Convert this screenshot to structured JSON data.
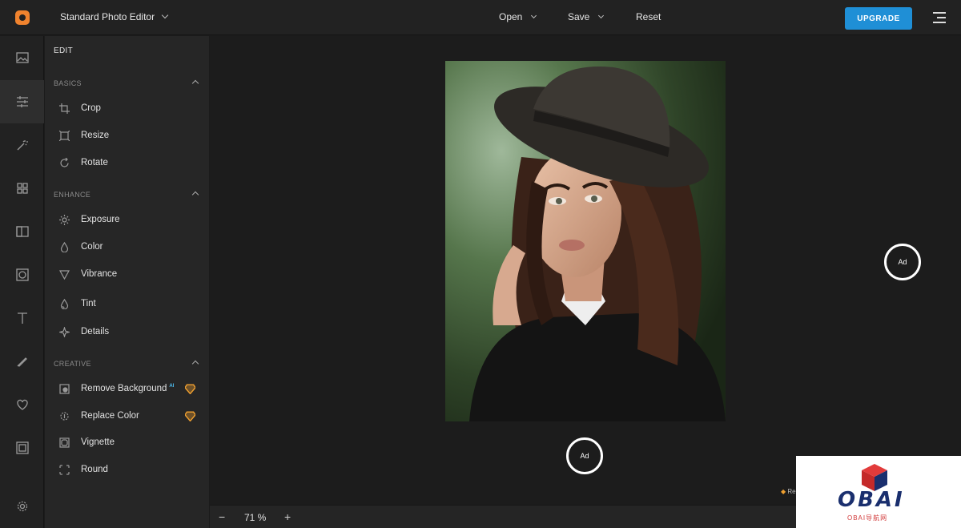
{
  "header": {
    "app_title": "Standard Photo Editor",
    "menu": [
      {
        "label": "Open"
      },
      {
        "label": "Save"
      },
      {
        "label": "Reset"
      }
    ],
    "upgrade_label": "UPGRADE"
  },
  "rail": {
    "items": [
      "image-icon",
      "sliders-icon",
      "magic-wand-icon",
      "grid-icon",
      "frame-icon",
      "overlay-icon",
      "text-icon",
      "brush-icon",
      "heart-icon",
      "border-icon",
      "settings-icon"
    ]
  },
  "panel": {
    "title": "EDIT",
    "sections": [
      {
        "name": "BASICS",
        "tools": [
          {
            "label": "Crop",
            "icon": "crop-icon"
          },
          {
            "label": "Resize",
            "icon": "resize-icon"
          },
          {
            "label": "Rotate",
            "icon": "rotate-icon"
          }
        ]
      },
      {
        "name": "ENHANCE",
        "tools": [
          {
            "label": "Exposure",
            "icon": "sun-icon"
          },
          {
            "label": "Color",
            "icon": "drop-icon"
          },
          {
            "label": "Vibrance",
            "icon": "triangle-icon"
          },
          {
            "label": "Tint",
            "icon": "tint-icon"
          },
          {
            "label": "Details",
            "icon": "sparkle-icon"
          }
        ]
      },
      {
        "name": "CREATIVE",
        "tools": [
          {
            "label": "Remove Background",
            "icon": "remove-bg-icon",
            "ai": "AI",
            "premium": true
          },
          {
            "label": "Replace Color",
            "icon": "replace-color-icon",
            "premium": true
          },
          {
            "label": "Vignette",
            "icon": "vignette-icon"
          },
          {
            "label": "Round",
            "icon": "round-icon"
          }
        ]
      }
    ]
  },
  "canvas": {
    "ad_label_right": "Ad",
    "ad_label_bottom": "Ad",
    "remove_ads": "Re"
  },
  "zoom": {
    "minus": "−",
    "value": "71 %",
    "plus": "+"
  },
  "watermark": {
    "logo_text": "OBAI",
    "sub_text": "OBAI导航网"
  },
  "colors": {
    "accent": "#1f8fd6",
    "logo": "#f0832e",
    "premium": "#f0a030"
  }
}
